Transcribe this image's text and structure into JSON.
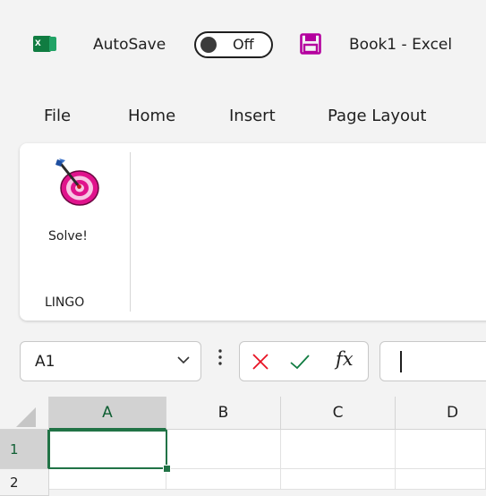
{
  "titlebar": {
    "app_icon": "excel-logo-icon",
    "app_icon_letter": "x",
    "autosave_label": "AutoSave",
    "autosave_state": "Off",
    "save_icon": "save-icon",
    "document_title": "Book1  -  Excel"
  },
  "menu": {
    "tabs": [
      "File",
      "Home",
      "Insert",
      "Page Layout"
    ]
  },
  "ribbon": {
    "solve_label": "Solve!",
    "solve_icon": "target-dart-icon",
    "group_label": "LINGO"
  },
  "formula_bar": {
    "name_box": "A1",
    "cancel_icon": "cancel-x-icon",
    "enter_icon": "check-icon",
    "fx_label": "fx",
    "formula_value": ""
  },
  "grid": {
    "columns": [
      "A",
      "B",
      "C",
      "D"
    ],
    "rows": [
      "1",
      "2"
    ],
    "active_cell": "A1"
  },
  "colors": {
    "excel_green": "#217346",
    "cancel_red": "#e81123",
    "check_green": "#107c41",
    "save_purple": "#b4009e",
    "target_pink": "#e0138c"
  }
}
